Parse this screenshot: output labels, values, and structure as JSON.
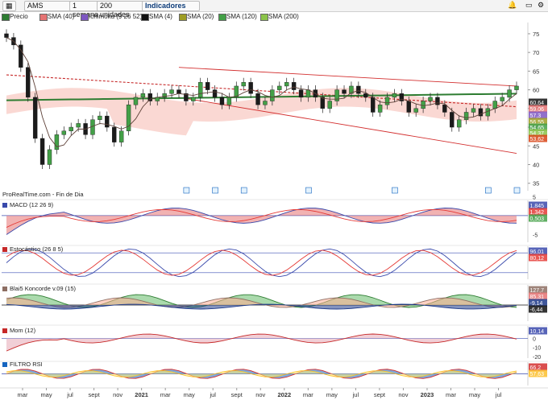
{
  "toolbar": {
    "symbol": "AMS",
    "interval": "1 semana",
    "units": "200 unidades",
    "indicators": "Indicadores"
  },
  "legend": [
    {
      "label": "Precio",
      "color": "#2e7d32"
    },
    {
      "label": "SMA (40)",
      "color": "#e57373"
    },
    {
      "label": "Ichimoku (9 26 52)",
      "color": "#7e57c2"
    },
    {
      "label": "SMA (4)",
      "color": "#111111"
    },
    {
      "label": "SMA (20)",
      "color": "#9e9d24"
    },
    {
      "label": "SMA (120)",
      "color": "#43a047"
    },
    {
      "label": "SMA (200)",
      "color": "#8bc34a"
    }
  ],
  "watermark": "ProRealTime.com - Fin de Dia",
  "panel_titles": {
    "macd": "MACD (12 26 9)",
    "stoch": "Estocástico (26 8 5)",
    "koncorde": "Blai5 Koncorde v.09 (15)",
    "mom": "Mom (12)",
    "rsi": "FILTRO RSI"
  },
  "x_labels": [
    "mar",
    "may",
    "jul",
    "sept",
    "nov",
    "2021",
    "mar",
    "may",
    "jul",
    "sept",
    "nov",
    "2022",
    "mar",
    "may",
    "jul",
    "sept",
    "nov",
    "2023",
    "mar",
    "may",
    "jul"
  ],
  "price_axis_ticks": [
    "75",
    "70",
    "65",
    "60",
    "55",
    "50",
    "45",
    "40",
    "35"
  ],
  "price_tags": [
    {
      "text": "60,64",
      "color": "#111111"
    },
    {
      "text": "59,06",
      "color": "#e57373"
    },
    {
      "text": "57,3",
      "color": "#7e57c2"
    },
    {
      "text": "56,55",
      "color": "#9e9d24"
    },
    {
      "text": "54,65",
      "color": "#43a047"
    },
    {
      "text": "54,37",
      "color": "#8bc34a"
    },
    {
      "text": "53,62",
      "color": "#d84315"
    }
  ],
  "macd_axis": [
    "5",
    "0",
    "-5"
  ],
  "macd_tags": [
    "1,845",
    "1,342",
    "0,503"
  ],
  "stoch_tags": [
    "96,01",
    "80,12"
  ],
  "koncorde_tags": [
    "127,7",
    "85,31",
    "-9,14",
    "-6,44"
  ],
  "mom_axis": [
    "0",
    "-10",
    "-20"
  ],
  "mom_tags": [
    "10,14"
  ],
  "rsi_tags": [
    "66,2",
    "57,63"
  ],
  "event_markers": [
    6,
    7,
    8,
    10,
    13,
    16,
    17
  ],
  "chart_data": {
    "type": "line",
    "title": "AMS",
    "interval": "1 semana",
    "x_start": "2020-01",
    "x_end": "2023-07",
    "price_ylim": [
      33,
      78
    ],
    "price_close_approx": [
      74,
      72,
      66,
      58,
      47,
      40,
      44,
      48,
      49,
      50,
      51,
      48,
      52,
      53,
      50,
      46,
      49,
      56,
      58,
      59,
      57,
      58,
      59,
      60,
      59,
      57,
      58,
      62,
      60,
      58,
      56,
      58,
      61,
      62,
      59,
      56,
      57,
      60,
      61,
      62,
      60,
      58,
      60,
      58,
      55,
      57,
      60,
      59,
      61,
      59,
      58,
      54,
      56,
      58,
      59,
      57,
      54,
      55,
      57,
      58,
      56,
      54,
      50,
      52,
      54,
      55,
      53,
      55,
      57,
      58,
      60,
      61
    ],
    "indicator_values": {
      "SMA (4)": 60.64,
      "SMA (40)": 59.06,
      "Ichimoku (9 26 52)": 57.3,
      "SMA (20)": 56.55,
      "SMA (120)": 54.65,
      "SMA (200)": 54.37
    },
    "macd": {
      "macd": 1.845,
      "signal": 1.342,
      "hist": 0.503,
      "ylim": [
        -7,
        4
      ]
    },
    "stochastic": {
      "k": 96.01,
      "d": 80.12,
      "ylim": [
        0,
        100
      ]
    },
    "momentum": {
      "value": 10.14,
      "ylim": [
        -22,
        14
      ]
    },
    "rsi_filter": {
      "upper": 66.2,
      "lower": 57.63
    }
  }
}
